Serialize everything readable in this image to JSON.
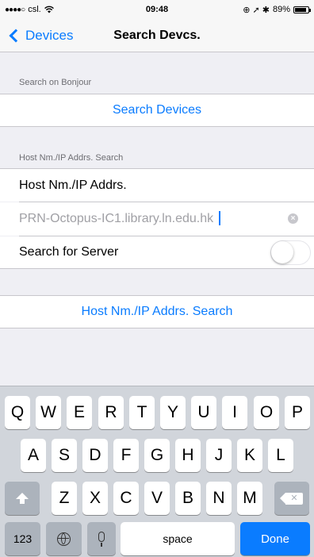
{
  "status_bar": {
    "signal": "●●●●○",
    "carrier": "csl.",
    "wifi": "wifi-icon",
    "time": "09:48",
    "right_icons": "⊕ ➚ ✱",
    "battery_percent": "89%",
    "battery_level": 0.89
  },
  "nav": {
    "back_label": "Devices",
    "title": "Search Devcs."
  },
  "bonjour": {
    "header": "Search on Bonjour",
    "button": "Search Devices"
  },
  "host_search": {
    "header": "Host Nm./IP Addrs. Search",
    "field_label": "Host Nm./IP Addrs.",
    "input_value": "PRN-Octopus-IC1.library.ln.edu.hk",
    "server_label": "Search for Server",
    "server_toggle": false,
    "search_button": "Host Nm./IP Addrs. Search"
  },
  "keyboard": {
    "row1": [
      "Q",
      "W",
      "E",
      "R",
      "T",
      "Y",
      "U",
      "I",
      "O",
      "P"
    ],
    "row2": [
      "A",
      "S",
      "D",
      "F",
      "G",
      "H",
      "J",
      "K",
      "L"
    ],
    "row3": [
      "Z",
      "X",
      "C",
      "V",
      "B",
      "N",
      "M"
    ],
    "numbers": "123",
    "space": "space",
    "done": "Done",
    "accent": "#0a7cff"
  }
}
